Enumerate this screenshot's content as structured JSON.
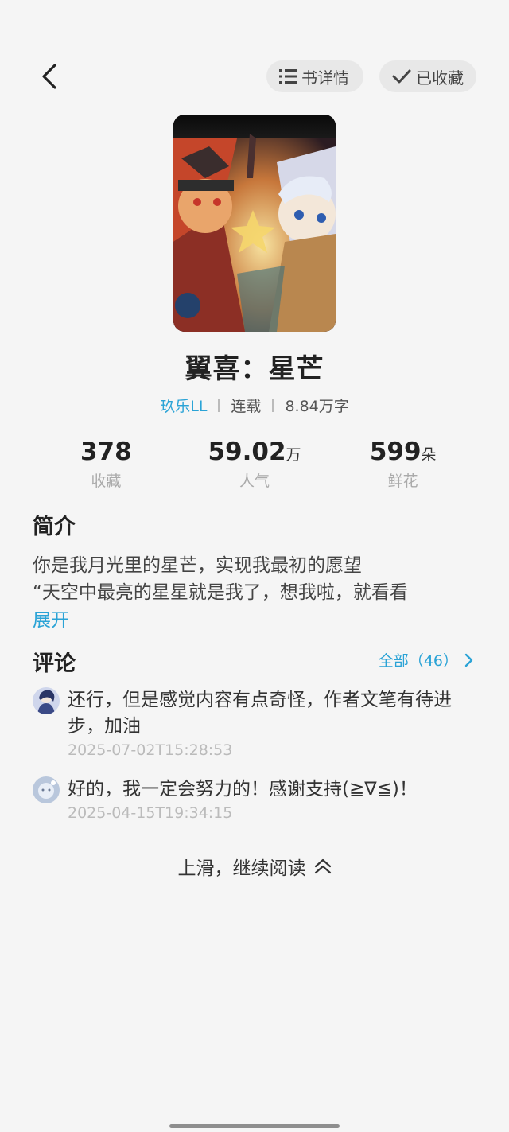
{
  "header": {
    "detail_label": "书详情",
    "favorited_label": "已收藏"
  },
  "book": {
    "title": "翼喜：星芒",
    "author": "玖乐LL",
    "status": "连载",
    "word_count": "8.84万字"
  },
  "stats": [
    {
      "value": "378",
      "unit": "",
      "label": "收藏"
    },
    {
      "value": "59.02",
      "unit": "万",
      "label": "人气"
    },
    {
      "value": "599",
      "unit": "朵",
      "label": "鲜花"
    }
  ],
  "intro": {
    "heading": "简介",
    "line1": "你是我月光里的星芒，实现我最初的愿望",
    "line2": "“天空中最亮的星星就是我了，想我啦，就看看",
    "expand_label": "展开"
  },
  "comments": {
    "heading": "评论",
    "all_label": "全部（46）",
    "items": [
      {
        "text": "还行，但是感觉内容有点奇怪，作者文笔有待进步，加油",
        "time": "2025-07-02T15:28:53"
      },
      {
        "text": "好的，我一定会努力的！感谢支持(≧∇≦)！",
        "time": "2025-04-15T19:34:15"
      }
    ]
  },
  "footer": {
    "continue_label": "上滑，继续阅读"
  },
  "colors": {
    "accent": "#2aa3d6",
    "background": "#f5f5f5"
  }
}
